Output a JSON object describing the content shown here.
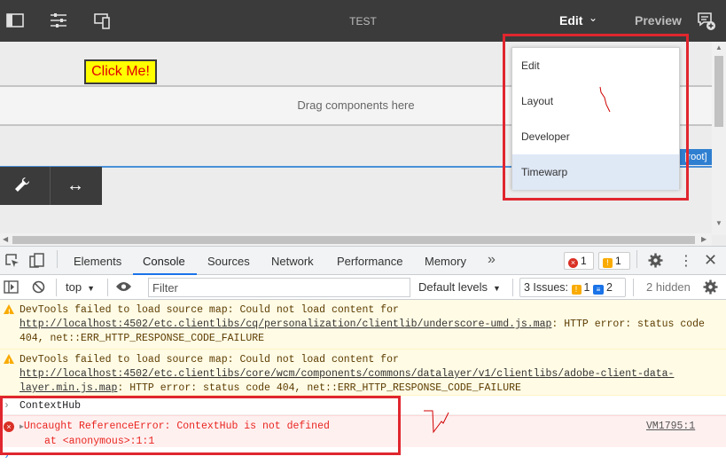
{
  "editor": {
    "page_title": "TEST",
    "mode_label": "Edit",
    "preview_label": "Preview",
    "click_me_label": "Click Me!",
    "dropzone_text": "Drag components here",
    "root_tag": "[root]"
  },
  "mode_menu": {
    "items": [
      "Edit",
      "Layout",
      "Developer",
      "Timewarp"
    ],
    "highlighted": "Timewarp"
  },
  "devtools": {
    "tabs": [
      "Elements",
      "Console",
      "Sources",
      "Network",
      "Performance",
      "Memory"
    ],
    "active_tab": "Console",
    "overflow": "»",
    "error_count": "1",
    "warning_count": "1",
    "context": "top",
    "filter_placeholder": "Filter",
    "levels": "Default levels",
    "issues_label": "3 Issues:",
    "issues_warn": "1",
    "issues_info": "2",
    "hidden": "2 hidden",
    "messages": [
      {
        "level": "warning",
        "prefix": "DevTools failed to load source map: Could not load content for ",
        "link": "http://localhost:4502/etc.clientlibs/cq/personalization/clientlib/underscore-umd.js.map",
        "suffix": ": HTTP error: status code 404, net::ERR_HTTP_RESPONSE_CODE_FAILURE"
      },
      {
        "level": "warning",
        "prefix": "DevTools failed to load source map: Could not load content for ",
        "link": "http://localhost:4502/etc.clientlibs/core/wcm/components/commons/datalayer/v1/clientlibs/adobe-client-data-layer.min.js.map",
        "suffix": ": HTTP error: status code 404, net::ERR_HTTP_RESPONSE_CODE_FAILURE"
      },
      {
        "level": "input",
        "text": "ContextHub"
      },
      {
        "level": "error",
        "text": "Uncaught ReferenceError: ContextHub is not defined",
        "stack": "at <anonymous>:1:1",
        "source": "VM1795:1"
      }
    ]
  },
  "colors": {
    "highlight_box": "#e0262e",
    "topbar": "#3b3b3b",
    "accent": "#1a73e8"
  }
}
